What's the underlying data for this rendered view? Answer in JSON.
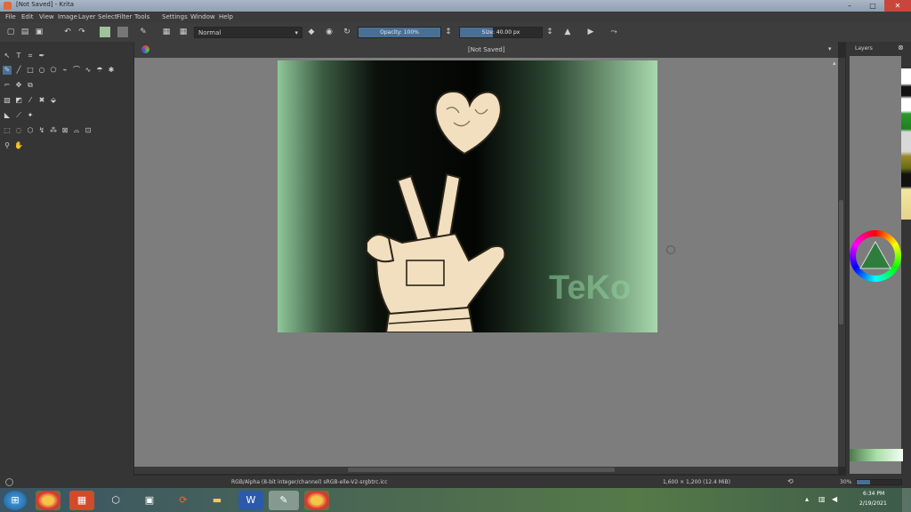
{
  "window": {
    "title": "[Not Saved] - Krita",
    "controls": [
      "–",
      "□",
      "✕"
    ]
  },
  "menu": [
    "File",
    "Edit",
    "View",
    "Image",
    "Layer",
    "Select",
    "Filter",
    "Tools",
    "Settings",
    "Window",
    "Help"
  ],
  "toolbar": {
    "blend_mode": "Normal",
    "opacity_label": "Opacity: 100%",
    "opacity_value": 1.0,
    "size_label": "Size: 40.00 px",
    "size_fraction": 0.4
  },
  "document": {
    "tab_label": "[Not Saved]",
    "watermark_text": "TeKo"
  },
  "status": {
    "color_info": "RGB/Alpha (8-bit integer/channel)  sRGB-elle-V2-srgbtrc.icc",
    "dimensions": "1,600 × 1,200 (12.4 MiB)",
    "zoom": "30%"
  },
  "docker": {
    "title": "Layers"
  },
  "taskbar": {
    "clock_time": "6:34 PM",
    "clock_date": "2/19/2021",
    "apps": [
      "start-orb-icon",
      "chrome-icon",
      "office-icon",
      "network-icon",
      "store-icon",
      "sync-icon",
      "folder-icon",
      "word-icon",
      "krita-icon",
      "chrome-icon"
    ]
  },
  "colors": {
    "accent": "#4a6f95",
    "canvas_bg": "#7d7d7d",
    "panel": "#353535"
  }
}
